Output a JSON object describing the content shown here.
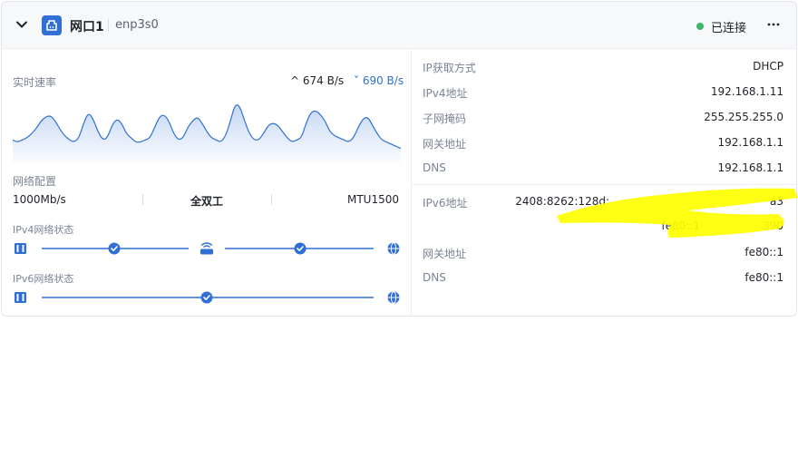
{
  "header": {
    "port_name": "网口1",
    "interface": "enp3s0",
    "status": "已连接",
    "status_color": "#40b66b",
    "collapse_icon": "chevron-down-icon",
    "more_icon": "more-horizontal-icon",
    "port_icon": "ethernet-port-icon"
  },
  "traffic": {
    "title": "实时速率",
    "upload": "674 B/s",
    "download": "690 B/s",
    "upload_arrow": "^",
    "download_arrow": "˅",
    "download_color": "#2f6fd6"
  },
  "chart_data": {
    "type": "area",
    "title": "",
    "series": [
      {
        "values": [
          22,
          20,
          22,
          24,
          28,
          33,
          40,
          44,
          45,
          40,
          32,
          26,
          22,
          20,
          24,
          38,
          48,
          42,
          30,
          22,
          24,
          36,
          42,
          38,
          28,
          24,
          20,
          20,
          22,
          24,
          34,
          44,
          46,
          40,
          28,
          22,
          24,
          34,
          40,
          44,
          38,
          30,
          24,
          22,
          20,
          26,
          40,
          56,
          54,
          40,
          28,
          22,
          22,
          28,
          36,
          38,
          36,
          30,
          24,
          20,
          22,
          24,
          38,
          48,
          50,
          46,
          40,
          30,
          26,
          24,
          22,
          20,
          24,
          34,
          42,
          44,
          36,
          28,
          22,
          20,
          18,
          16,
          14
        ]
      }
    ],
    "grid": false,
    "legend": "none"
  },
  "network_config": {
    "title": "网络配置",
    "speed": "1000Mb/s",
    "duplex": "全双工",
    "mtu": "MTU1500"
  },
  "ipv4_status": {
    "title": "IPv4网络状态",
    "nodes": [
      "device-icon",
      "check-icon",
      "router-icon",
      "check-icon",
      "globe-icon"
    ]
  },
  "ipv6_status": {
    "title": "IPv6网络状态",
    "nodes": [
      "device-icon",
      "check-icon",
      "globe-icon"
    ]
  },
  "ipv4": {
    "rows": [
      {
        "label": "IP获取方式",
        "value": "DHCP"
      },
      {
        "label": "IPv4地址",
        "value": "192.168.1.11"
      },
      {
        "label": "子网掩码",
        "value": "255.255.255.0"
      },
      {
        "label": "网关地址",
        "value": "192.168.1.1"
      },
      {
        "label": "DNS",
        "value": "192.168.1.1"
      }
    ]
  },
  "ipv6": {
    "rows": [
      {
        "label": "IPv6地址",
        "value": "2408:8262:128d:",
        "value_tail": "a3"
      },
      {
        "label": "",
        "value": "fe80::1",
        "value_tail": "390"
      },
      {
        "label": "网关地址",
        "value": "fe80::1"
      },
      {
        "label": "DNS",
        "value": "fe80::1"
      }
    ]
  },
  "accent_color": "#2f6fd6",
  "highlight_color": "#ffff00"
}
